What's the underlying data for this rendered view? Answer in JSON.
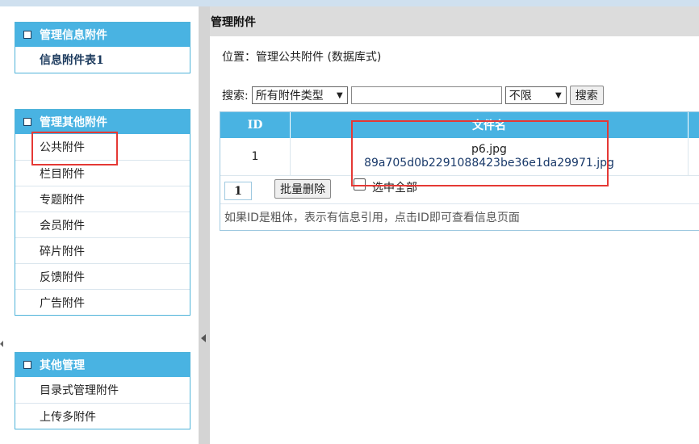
{
  "sidebar": {
    "panel1": {
      "title": "管理信息附件",
      "items": [
        "信息附件表1"
      ]
    },
    "panel2": {
      "title": "管理其他附件",
      "items": [
        "公共附件",
        "栏目附件",
        "专题附件",
        "会员附件",
        "碎片附件",
        "反馈附件",
        "广告附件"
      ]
    },
    "panel3": {
      "title": "其他管理",
      "items": [
        "目录式管理附件",
        "上传多附件"
      ]
    }
  },
  "main": {
    "header": "管理附件",
    "location": "位置：管理公共附件 (数据库式)",
    "search": {
      "label": "搜索:",
      "type_select": "所有附件类型",
      "keyword_value": "",
      "range_select": "不限",
      "button": "搜索"
    },
    "table": {
      "columns": [
        "ID",
        "文件名"
      ],
      "rows": [
        {
          "id": "1",
          "name": "p6.jpg",
          "stored_name": "89a705d0b2291088423be36e1da29971.jpg"
        }
      ]
    },
    "page_number": "1",
    "bulk_delete": "批量删除",
    "select_all": "选中全部",
    "note": "如果ID是粗体，表示有信息引用，点击ID即可查看信息页面"
  }
}
